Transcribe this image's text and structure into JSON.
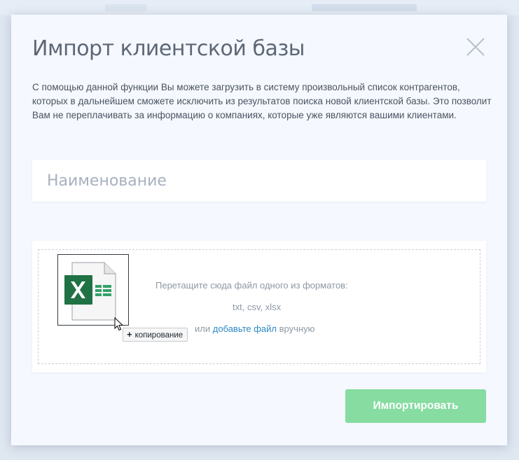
{
  "modal": {
    "title": "Импорт клиентской базы",
    "description": "С помощью данной функции Вы можете загрузить в систему произвольный список контрагентов, которых в дальнейшем сможете исключить из результатов поиска новой клиентской базы. Это позволит Вам не переплачивать за информацию о компаниях, которые уже являются вашими клиентами."
  },
  "name_field": {
    "value": "",
    "placeholder": "Наименование"
  },
  "upload": {
    "drop_hint": "Перетащите сюда файл одного из форматов:",
    "formats": "txt, csv, xlsx",
    "or_text": "или",
    "add_file_link": "добавьте файл",
    "manual_text": "вручную",
    "dragged_file_icon": "excel-file-icon",
    "drag_tooltip": "копирование",
    "drag_tooltip_icon": "plus-icon"
  },
  "actions": {
    "import_label": "Импортировать"
  },
  "colors": {
    "excel_green": "#207245",
    "import_button": "#86dca1",
    "link": "#2e89c4"
  }
}
